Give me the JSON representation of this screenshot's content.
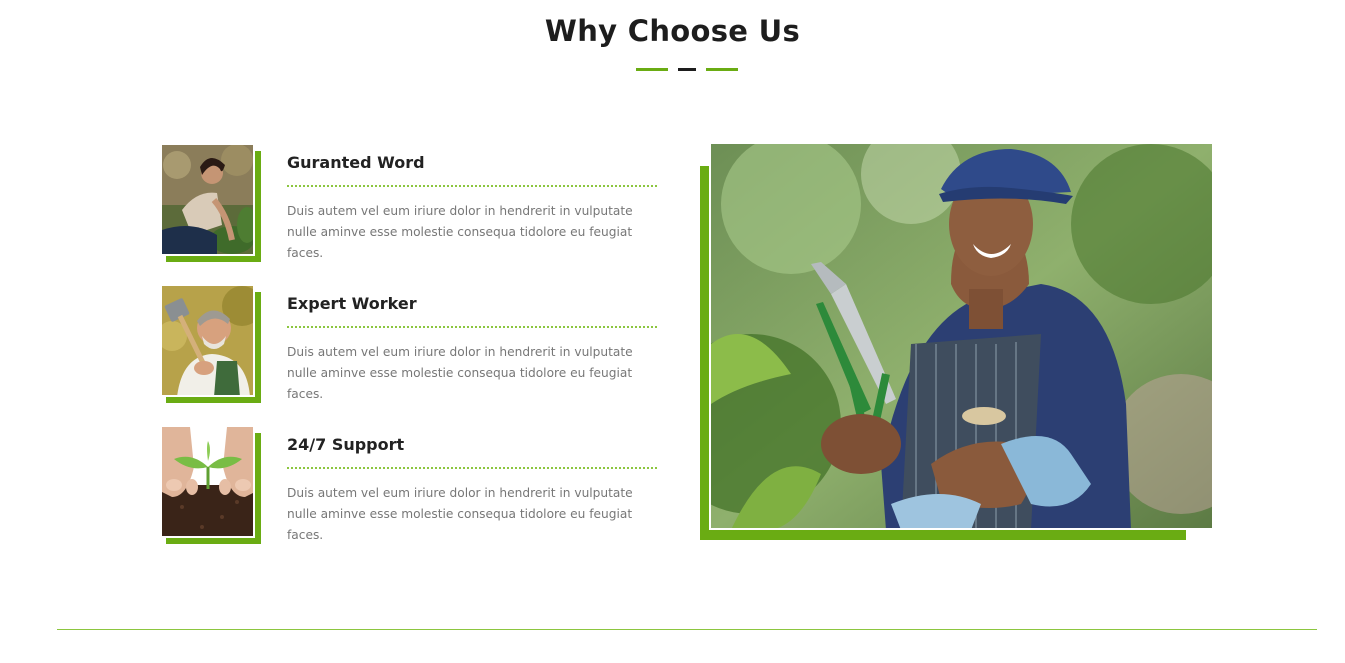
{
  "section": {
    "title": "Why Choose Us"
  },
  "features": [
    {
      "title": "Guranted Word",
      "text": "Duis autem vel eum iriure dolor in hendrerit in vulputate nulle aminve esse molestie consequa tidolore eu feugiat faces.",
      "image": "woman-gardening-photo"
    },
    {
      "title": "Expert Worker",
      "text": "Duis autem vel eum iriure dolor in hendrerit in vulputate nulle aminve esse molestie consequa tidolore eu feugiat faces.",
      "image": "older-man-with-shovel-photo"
    },
    {
      "title": "24/7 Support",
      "text": "Duis autem vel eum iriure dolor in hendrerit in vulputate nulle aminve esse molestie consequa tidolore eu feugiat faces.",
      "image": "hands-with-seedling-photo"
    }
  ],
  "hero": {
    "image": "smiling-gardener-with-shears-photo"
  },
  "colors": {
    "accent": "#6aac13",
    "heading": "#1d1d1d",
    "body_text": "#777777"
  }
}
